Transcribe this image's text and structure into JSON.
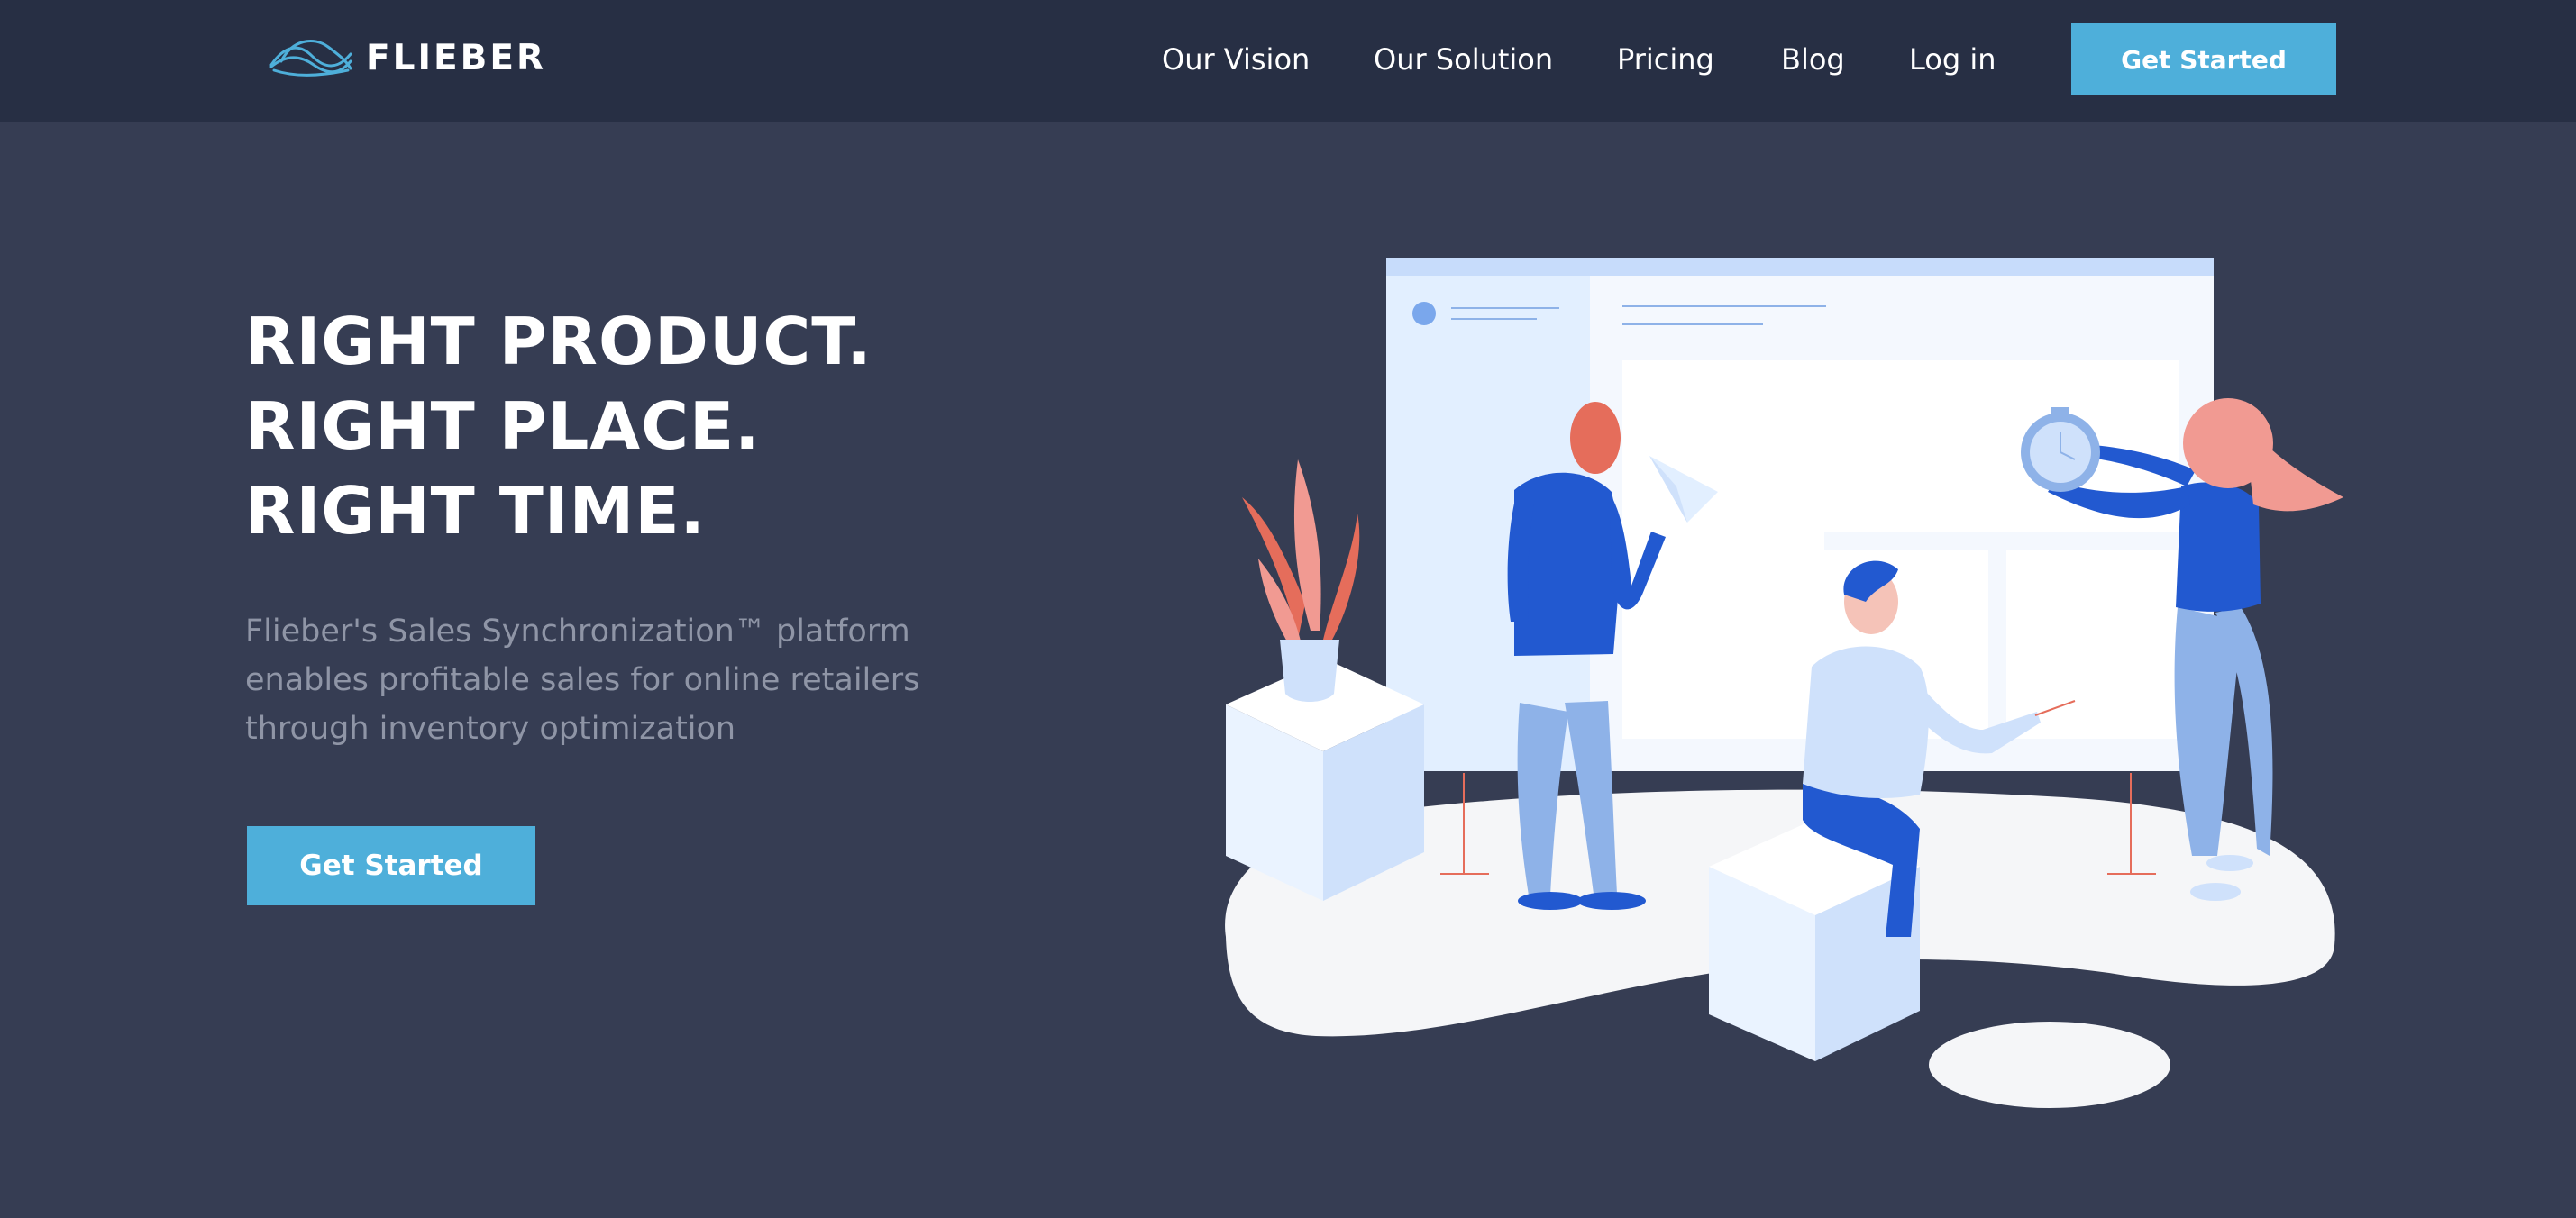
{
  "brand": {
    "name": "FLIEBER",
    "accent": "#4eafda"
  },
  "nav": {
    "links": [
      "Our Vision",
      "Our Solution",
      "Pricing",
      "Blog",
      "Log in"
    ],
    "cta_label": "Get Started"
  },
  "hero": {
    "title_lines": [
      "RIGHT PRODUCT.",
      "RIGHT PLACE.",
      "RIGHT TIME."
    ],
    "description": "Flieber's Sales Synchronization™ platform enables profitable sales for online retailers through inventory optimization",
    "cta_label": "Get Started"
  },
  "colors": {
    "nav_bg": "#272f44",
    "page_bg": "#363d53",
    "text_muted": "#8f95a6"
  }
}
